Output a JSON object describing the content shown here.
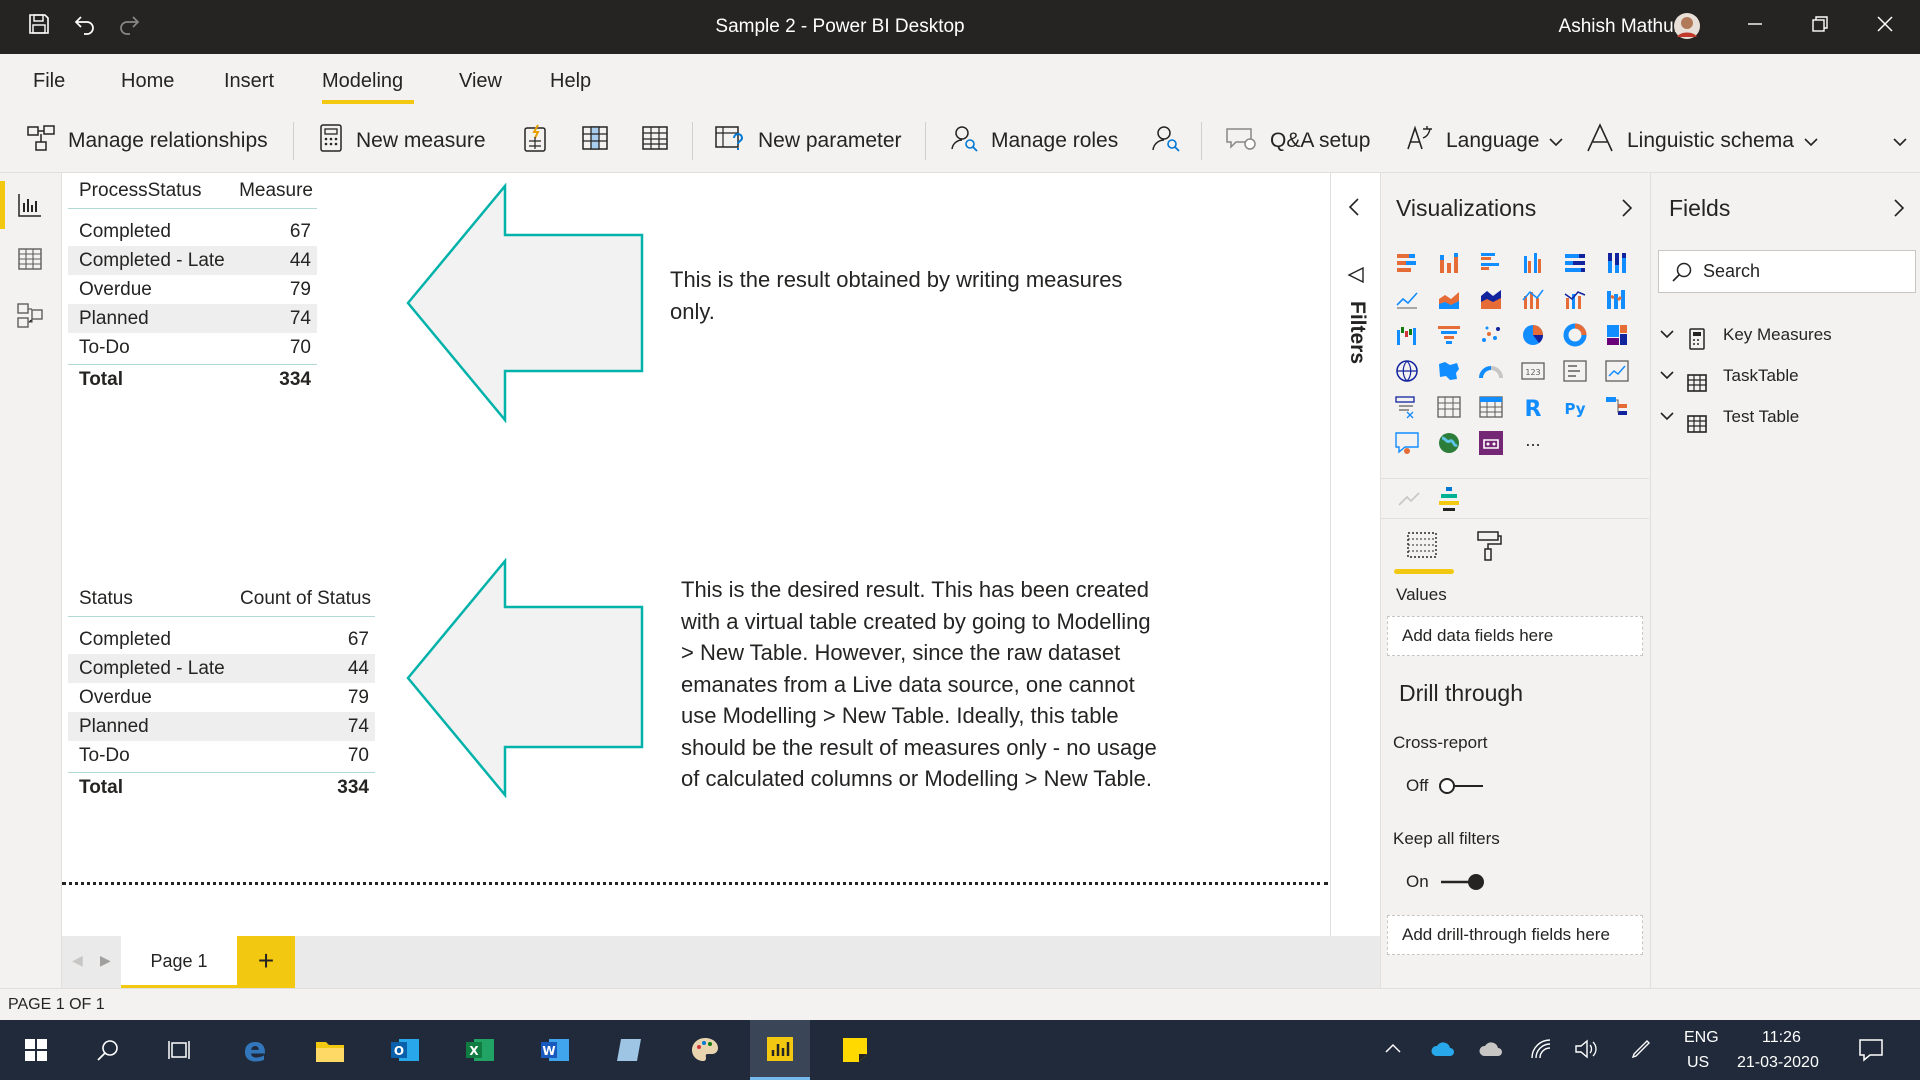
{
  "titlebar": {
    "title": "Sample 2 - Power BI Desktop",
    "user": "Ashish Mathur"
  },
  "menu": {
    "file": "File",
    "home": "Home",
    "insert": "Insert",
    "modeling": "Modeling",
    "view": "View",
    "help": "Help"
  },
  "ribbon": {
    "manage_relationships": "Manage relationships",
    "new_measure": "New measure",
    "new_parameter": "New parameter",
    "manage_roles": "Manage roles",
    "qa_setup": "Q&A setup",
    "language": "Language",
    "linguistic_schema": "Linguistic schema"
  },
  "table1": {
    "col1": "ProcessStatus",
    "col2": "Measure",
    "rows": [
      {
        "label": "Completed",
        "value": "67"
      },
      {
        "label": "Completed - Late",
        "value": "44"
      },
      {
        "label": "Overdue",
        "value": "79"
      },
      {
        "label": "Planned",
        "value": "74"
      },
      {
        "label": "To-Do",
        "value": "70"
      }
    ],
    "total_label": "Total",
    "total_value": "334"
  },
  "table2": {
    "col1": "Status",
    "col2": "Count of Status",
    "rows": [
      {
        "label": "Completed",
        "value": "67"
      },
      {
        "label": "Completed - Late",
        "value": "44"
      },
      {
        "label": "Overdue",
        "value": "79"
      },
      {
        "label": "Planned",
        "value": "74"
      },
      {
        "label": "To-Do",
        "value": "70"
      }
    ],
    "total_label": "Total",
    "total_value": "334"
  },
  "note1": [
    "This is the result obtained by writing measures",
    "only."
  ],
  "note2": [
    "This is the desired result.  This has been created",
    "with a virtual table created by going to Modelling",
    "> New Table.  However, since the raw dataset",
    "emanates from a Live data source, one cannot",
    "use Modelling > New Table.  Ideally, this table",
    "should be the result of measures only - no usage",
    "of calculated columns or Modelling > New Table."
  ],
  "pages": {
    "page1": "Page 1",
    "add": "+"
  },
  "status": "PAGE 1 OF 1",
  "filters": {
    "label": "Filters"
  },
  "visualizations": {
    "title": "Visualizations",
    "values_label": "Values",
    "add_data_fields": "Add data fields here",
    "drill_through": "Drill through",
    "cross_report": "Cross-report",
    "cross_report_state": "Off",
    "keep_all_filters": "Keep all filters",
    "keep_all_filters_state": "On",
    "add_drill_fields": "Add drill-through fields here",
    "r_label": "R",
    "py_label": "Py",
    "more": "..."
  },
  "fields": {
    "title": "Fields",
    "search_placeholder": "Search",
    "items": [
      {
        "label": "Key Measures"
      },
      {
        "label": "TaskTable"
      },
      {
        "label": "Test Table"
      }
    ]
  },
  "taskbar": {
    "lang1": "ENG",
    "lang2": "US",
    "time": "11:26",
    "date": "21-03-2020"
  },
  "colors": {
    "accent": "#f2c811",
    "arrow_stroke": "#00b2a9",
    "arrow_fill": "#f2f2f2"
  }
}
